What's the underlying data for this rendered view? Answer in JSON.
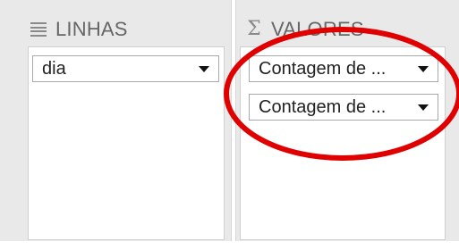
{
  "rows_pane": {
    "title": "LINHAS",
    "icon": "rows-list-icon",
    "fields": [
      {
        "label": "dia"
      }
    ]
  },
  "values_pane": {
    "title": "VALORES",
    "icon": "sigma-icon",
    "icon_glyph": "Σ",
    "fields": [
      {
        "label": "Contagem de ..."
      },
      {
        "label": "Contagem de ..."
      }
    ]
  },
  "annotation": {
    "shape": "ellipse",
    "color": "#e00000"
  },
  "colors": {
    "pane_background": "#e9e9e9",
    "title_text": "#666666"
  }
}
